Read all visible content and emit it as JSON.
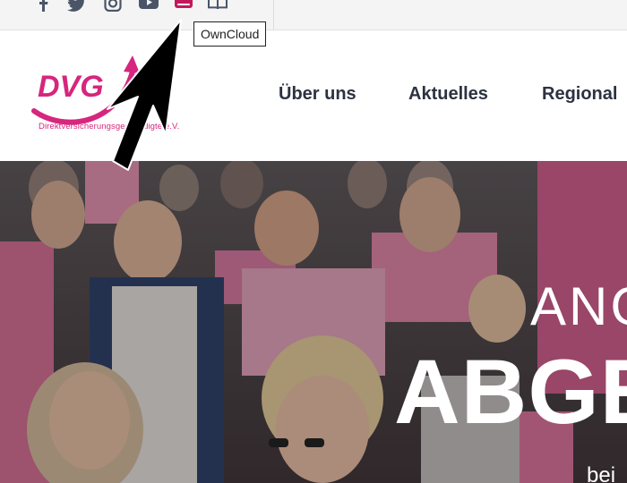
{
  "topbar": {
    "icons": [
      "facebook-icon",
      "twitter-icon",
      "instagram-icon",
      "youtube-icon",
      "owncloud-icon",
      "book-icon"
    ],
    "tooltip": "OwnCloud"
  },
  "logo": {
    "letters": "DVG",
    "tagline": "Direktversicherungsgeschädigte e.V."
  },
  "nav": {
    "items": [
      "Über uns",
      "Aktuelles",
      "Regional"
    ]
  },
  "hero": {
    "line1": "ANG",
    "line2": "ABGE",
    "line3": "bei"
  },
  "colors": {
    "brand_pink": "#d6267e",
    "nav_text": "#2c3240",
    "topbar_bg": "#f4f4f4"
  }
}
